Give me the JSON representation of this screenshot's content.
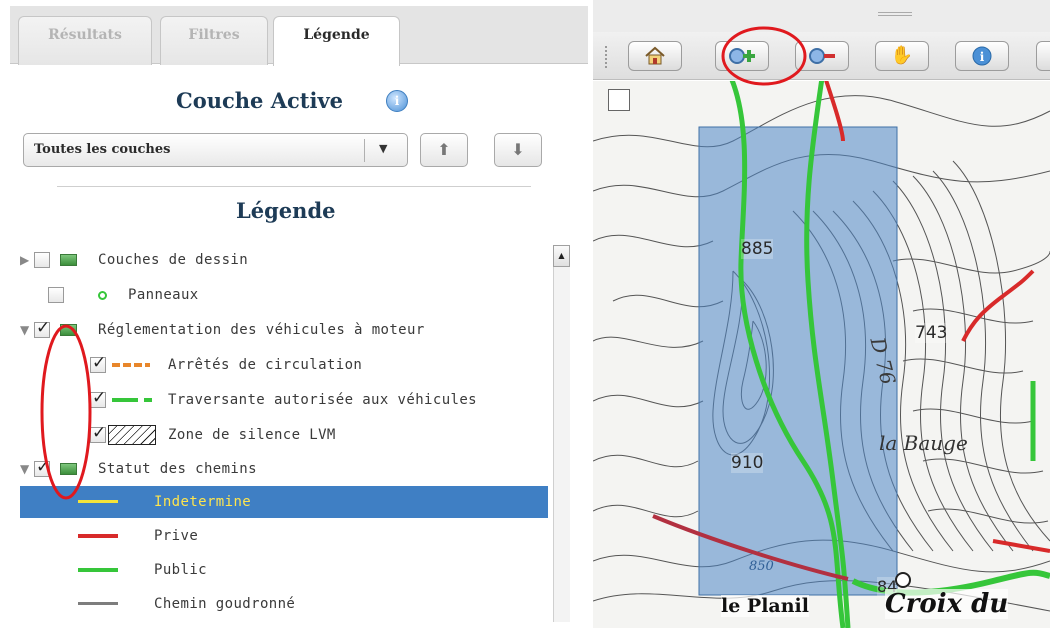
{
  "tabs": [
    {
      "label": "Résultats"
    },
    {
      "label": "Filtres"
    },
    {
      "label": "Légende"
    }
  ],
  "couche_active": {
    "title": "Couche Active",
    "info_icon": "info-icon"
  },
  "layer_select": {
    "value": "Toutes les couches"
  },
  "legend": {
    "title": "Légende",
    "items": [
      {
        "label": "Couches de dessin",
        "expanded": false,
        "checked": false
      },
      {
        "label": "Panneaux",
        "checked": false
      },
      {
        "label": "Réglementation des véhicules à moteur",
        "expanded": true,
        "checked": true
      },
      {
        "label": "Arrêtés de circulation",
        "checked": true
      },
      {
        "label": "Traversante autorisée aux véhicules",
        "checked": true
      },
      {
        "label": "Zone de silence LVM",
        "checked": true
      },
      {
        "label": "Statut des chemins",
        "expanded": true,
        "checked": true
      },
      {
        "label": "Indetermine",
        "selected": true
      },
      {
        "label": "Prive"
      },
      {
        "label": "Public"
      },
      {
        "label": "Chemin goudronné"
      }
    ]
  },
  "map": {
    "toolbar": [
      "home-icon",
      "zoom-in-icon",
      "zoom-out-icon",
      "pan-hand-icon",
      "info-icon"
    ],
    "elevations": [
      "885",
      "743",
      "910",
      "84"
    ],
    "road_label": "D 76",
    "places": [
      "la Bauge",
      "le Planil",
      "Croix du"
    ],
    "contour_label": "850"
  },
  "colors": {
    "selection": "#3f7fc4",
    "selected_text": "#ffe54d",
    "title": "#1d3b56",
    "trail_green": "#36c63a",
    "trail_red": "#d82a2a",
    "highlight_rect": "#4f86c6",
    "annotation_red": "#e0191e"
  }
}
